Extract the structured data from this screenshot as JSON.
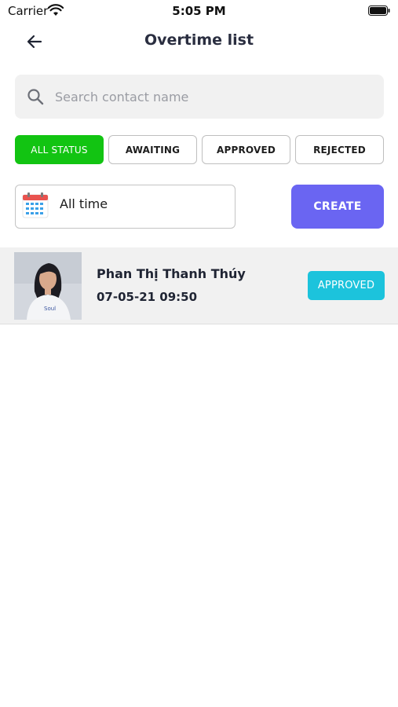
{
  "status_bar": {
    "carrier": "Carrier",
    "time": "5:05 PM"
  },
  "header": {
    "title": "Overtime list",
    "back_icon": "arrow-left-icon"
  },
  "search": {
    "placeholder": "Search contact name",
    "value": "",
    "icon": "search-icon"
  },
  "filters": [
    {
      "label": "ALL STATUS",
      "active": true
    },
    {
      "label": "AWAITING",
      "active": false
    },
    {
      "label": "APPROVED",
      "active": false
    },
    {
      "label": "REJECTED",
      "active": false
    }
  ],
  "date_filter": {
    "label": "All time",
    "icon": "calendar-icon"
  },
  "create_button": {
    "label": "CREATE"
  },
  "colors": {
    "active_filter": "#12c412",
    "create": "#6a65f2",
    "approved_badge": "#1cc3dc"
  },
  "items": [
    {
      "name": "Phan Thị Thanh Thúy",
      "datetime": "07-05-21 09:50",
      "status": "APPROVED"
    }
  ]
}
